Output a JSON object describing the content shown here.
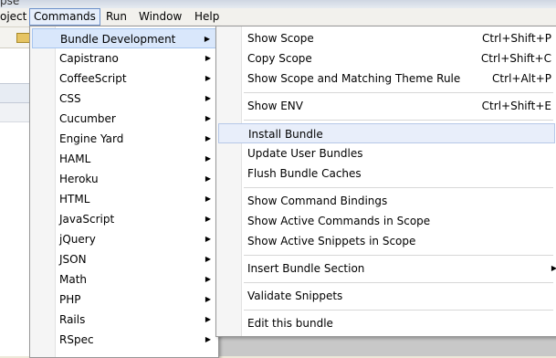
{
  "window": {
    "title": "pse"
  },
  "menubar": {
    "items": [
      {
        "label": "oject"
      },
      {
        "label": "Commands",
        "active": true
      },
      {
        "label": "Run"
      },
      {
        "label": "Window"
      },
      {
        "label": "Help"
      }
    ]
  },
  "commands_menu": {
    "items": [
      {
        "label": "Bundle Development",
        "submenu": true,
        "highlighted": true
      },
      {
        "label": "Capistrano",
        "submenu": true
      },
      {
        "label": "CoffeeScript",
        "submenu": true
      },
      {
        "label": "CSS",
        "submenu": true
      },
      {
        "label": "Cucumber",
        "submenu": true
      },
      {
        "label": "Engine Yard",
        "submenu": true
      },
      {
        "label": "HAML",
        "submenu": true
      },
      {
        "label": "Heroku",
        "submenu": true
      },
      {
        "label": "HTML",
        "submenu": true
      },
      {
        "label": "JavaScript",
        "submenu": true
      },
      {
        "label": "jQuery",
        "submenu": true
      },
      {
        "label": "JSON",
        "submenu": true
      },
      {
        "label": "Math",
        "submenu": true
      },
      {
        "label": "PHP",
        "submenu": true
      },
      {
        "label": "Rails",
        "submenu": true
      },
      {
        "label": "RSpec",
        "submenu": true
      }
    ]
  },
  "bundle_dev_menu": {
    "items": [
      {
        "label": "Show Scope",
        "shortcut": "Ctrl+Shift+P"
      },
      {
        "label": "Copy Scope",
        "shortcut": "Ctrl+Shift+C"
      },
      {
        "label": "Show Scope and Matching Theme Rule",
        "shortcut": "Ctrl+Alt+P"
      },
      {
        "label": "Show ENV",
        "shortcut": "Ctrl+Shift+E"
      },
      {
        "label": "Install Bundle",
        "highlighted": true
      },
      {
        "label": "Update User Bundles"
      },
      {
        "label": "Flush Bundle Caches"
      },
      {
        "label": "Show Command Bindings"
      },
      {
        "label": "Show Active Commands in Scope"
      },
      {
        "label": "Show Active Snippets in Scope"
      },
      {
        "label": "Insert Bundle Section",
        "submenu": true
      },
      {
        "label": "Validate Snippets"
      },
      {
        "label": "Edit this bundle"
      }
    ]
  },
  "icons": {
    "submenu_arrow": "▶"
  },
  "colors": {
    "highlight": "#d9e7fb",
    "menubar_active": "#e6eefb"
  }
}
